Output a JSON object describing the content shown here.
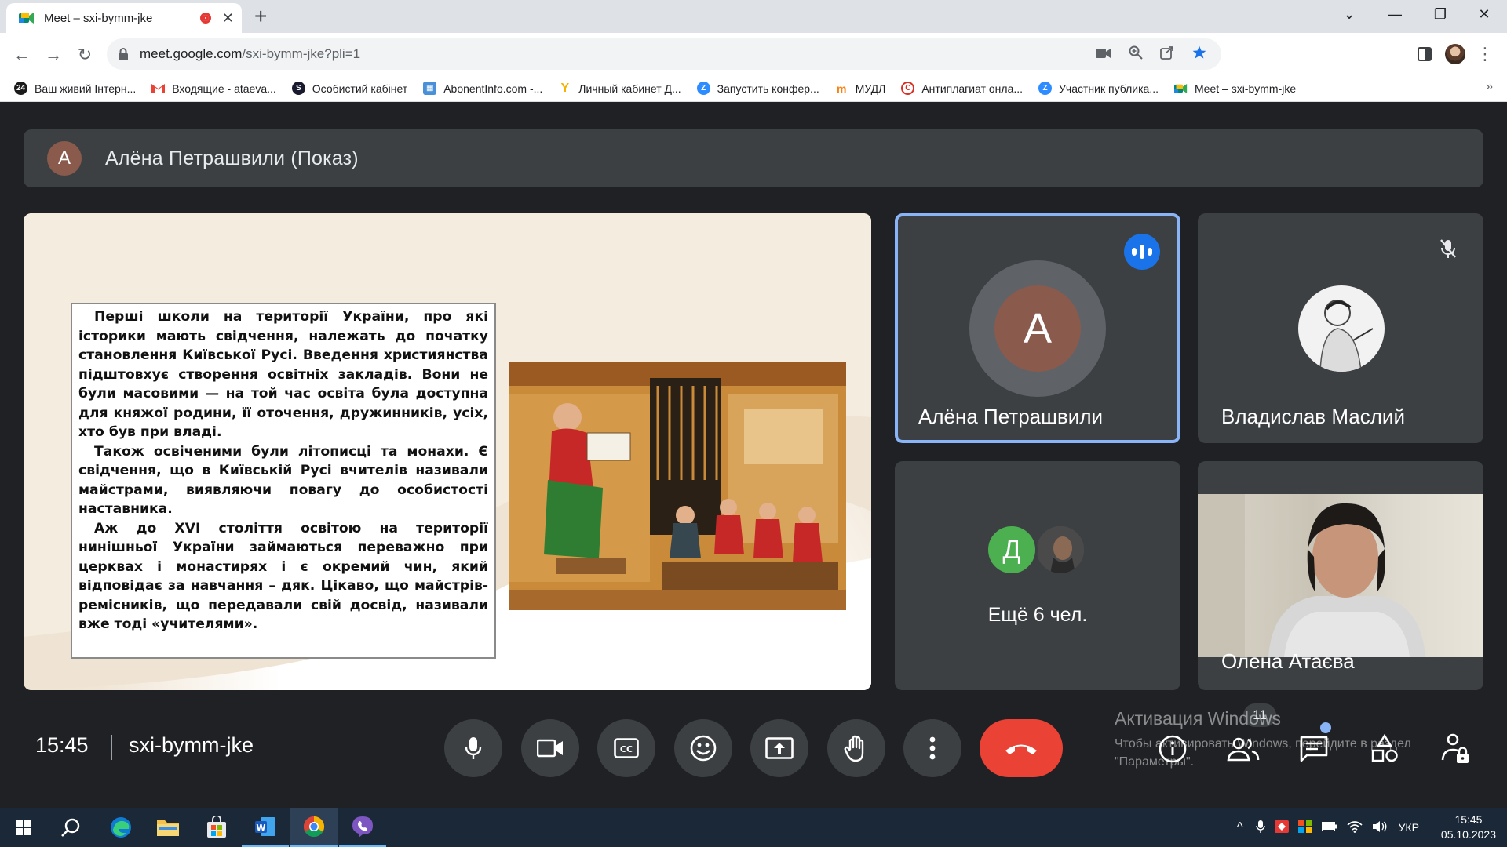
{
  "browser": {
    "tab_title": "Meet – sxi-bymm-jke",
    "url_host": "meet.google.com",
    "url_path": "/sxi-bymm-jke?pli=1",
    "bookmarks": [
      {
        "label": "Ваш живий Інтерн...",
        "icon": "24-icon",
        "color": "#1b1b1b"
      },
      {
        "label": "Входящие - ataeva...",
        "icon": "gmail-icon",
        "color": "#ea4335"
      },
      {
        "label": "Особистий кабінет",
        "icon": "swirl-icon",
        "color": "#1a1a2e"
      },
      {
        "label": "AbonentInfo.com -...",
        "icon": "grid-icon",
        "color": "#4a90d9"
      },
      {
        "label": "Личный кабинет Д...",
        "icon": "y-icon",
        "color": "#f5b301"
      },
      {
        "label": "Запустить конфер...",
        "icon": "zoom-icon",
        "color": "#2d8cff"
      },
      {
        "label": "МУДЛ",
        "icon": "moodle-icon",
        "color": "#f98012"
      },
      {
        "label": "Антиплагиат онла...",
        "icon": "c-icon",
        "color": "#d93025"
      },
      {
        "label": "Участник публика...",
        "icon": "zoom-icon",
        "color": "#2d8cff"
      },
      {
        "label": "Meet – sxi-bymm-jke",
        "icon": "meet-icon",
        "color": "#00897b"
      }
    ]
  },
  "meet": {
    "presenter_initial": "А",
    "presenter_label": "Алёна Петрашвили (Показ)",
    "slide_paragraphs": [
      "Перші школи на території України, про які історики мають свідчення, належать до початку становлення Київської Русі. Введення християнства підштовхує створення освітніх закладів. Вони не були масовими — на той час освіта була доступна для княжої родини, її оточення, дружинників, усіх, хто був при владі.",
      "Також освіченими були літописці та монахи. Є свідчення, що в Київській Русі вчителів називали майстрами, виявляючи повагу до особистості наставника.",
      "Аж до XVI століття освітою на території нинішньої України займаються переважно при церквах і монастирях і є окремий чин, який відповідає за навчання – дяк. Цікаво, що майстрів-ремісників, що передавали свій досвід, називали вже тоді «учителями»."
    ],
    "participants": {
      "p1_initial": "А",
      "p1_name": "Алёна Петрашвили",
      "p2_name": "Владислав Маслий",
      "others_initial": "Д",
      "others_label": "Ещё 6 чел.",
      "p4_name": "Олена Атаєва"
    },
    "time": "15:45",
    "meeting_code": "sxi-bymm-jke",
    "participant_count": "11",
    "watermark_title": "Активация Windows",
    "watermark_sub": "Чтобы активировать Windows, перейдите в раздел \"Параметры\"."
  },
  "taskbar": {
    "lang": "УКР",
    "time": "15:45",
    "date": "05.10.2023"
  },
  "colors": {
    "meet_bg": "#202124",
    "tile_bg": "#3c4043",
    "active_border": "#8ab4f8",
    "end_call": "#ea4335",
    "speaking": "#1a73e8"
  }
}
